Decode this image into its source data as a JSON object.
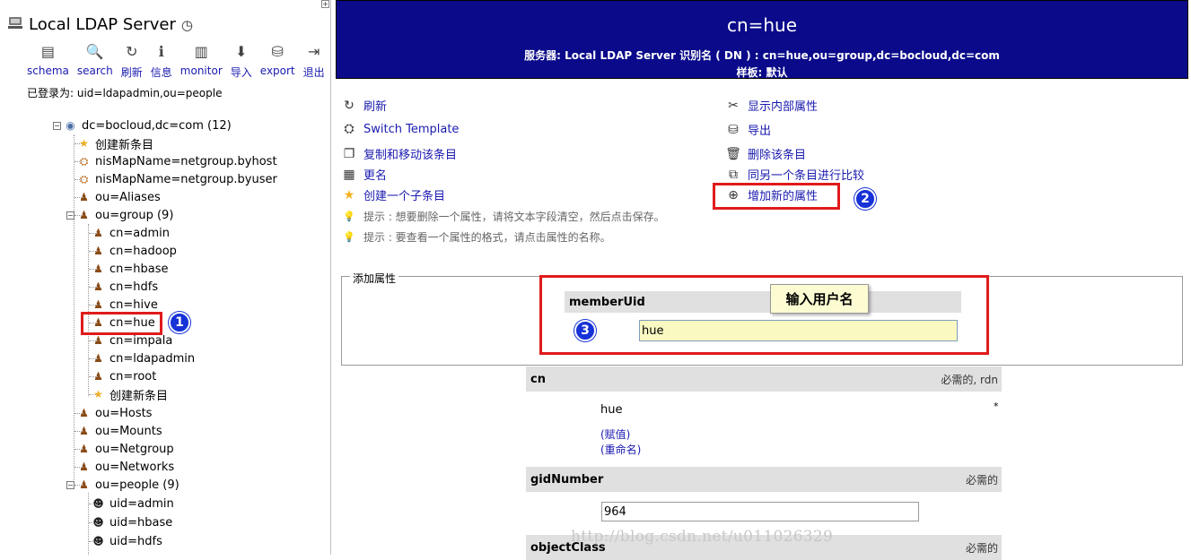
{
  "sidebar": {
    "server_title": "Local LDAP Server",
    "toolbar": [
      {
        "label": "schema",
        "icon": "schema-icon",
        "glyph": "▤"
      },
      {
        "label": "search",
        "icon": "search-icon",
        "glyph": "🔍"
      },
      {
        "label": "刷新",
        "icon": "refresh-icon",
        "glyph": "↻"
      },
      {
        "label": "信息",
        "icon": "info-icon",
        "glyph": "ℹ"
      },
      {
        "label": "monitor",
        "icon": "monitor-icon",
        "glyph": "▥"
      },
      {
        "label": "导入",
        "icon": "import-icon",
        "glyph": "⬇"
      },
      {
        "label": "export",
        "icon": "export-icon",
        "glyph": "⛁"
      },
      {
        "label": "退出",
        "icon": "logout-icon",
        "glyph": "⇥"
      }
    ],
    "logged_in": "已登录为: uid=ldapadmin,ou=people",
    "tree": {
      "root": "dc=bocloud,dc=com (12)",
      "create_new": "创建新条目",
      "items": [
        "nisMapName=netgroup.byhost",
        "nisMapName=netgroup.byuser",
        "ou=Aliases"
      ],
      "group": "ou=group (9)",
      "group_children": [
        "cn=admin",
        "cn=hadoop",
        "cn=hbase",
        "cn=hdfs",
        "cn=hive",
        "cn=hue",
        "cn=impala",
        "cn=ldapadmin",
        "cn=root"
      ],
      "group_create": "创建新条目",
      "others": [
        "ou=Hosts",
        "ou=Mounts",
        "ou=Netgroup",
        "ou=Networks"
      ],
      "people": "ou=people (9)",
      "people_children": [
        "uid=admin",
        "uid=hbase",
        "uid=hdfs"
      ]
    }
  },
  "header": {
    "dn_title": "cn=hue",
    "server_line": "服务器: Local LDAP Server   识别名 ( DN ) : cn=hue,ou=group,dc=bocloud,dc=com",
    "template_line": "样板: 默认"
  },
  "actions_left": [
    {
      "label": "刷新",
      "icon": "refresh-icon",
      "glyph": "↻"
    },
    {
      "label": "Switch Template",
      "icon": "switch-template-icon",
      "glyph": "⛭"
    },
    {
      "label": "复制和移动该条目",
      "icon": "copy-icon",
      "glyph": "❐"
    },
    {
      "label": "更名",
      "icon": "rename-icon",
      "glyph": "▦"
    },
    {
      "label": "创建一个子条目",
      "icon": "star-icon",
      "glyph": "★"
    }
  ],
  "hints": [
    "提示 : 想要删除一个属性，请将文本字段清空，然后点击保存。",
    "提示 : 要查看一个属性的格式，请点击属性的名称。"
  ],
  "actions_right": [
    {
      "label": "显示内部属性",
      "icon": "tools-icon",
      "glyph": "✂"
    },
    {
      "label": "导出",
      "icon": "export-icon",
      "glyph": "⛁"
    },
    {
      "label": "删除该条目",
      "icon": "trash-icon",
      "glyph": "🗑"
    },
    {
      "label": "同另一个条目进行比较",
      "icon": "compare-icon",
      "glyph": "⧉"
    },
    {
      "label": "增加新的属性",
      "icon": "add-attribute-icon",
      "glyph": "⊕"
    }
  ],
  "add_attr": {
    "legend": "添加属性",
    "attr_name": "memberUid",
    "tip": "输入用户名",
    "value": "hue"
  },
  "attributes": {
    "cn": {
      "name": "cn",
      "tag": "必需的, rdn",
      "value": "hue",
      "star": "*",
      "link1": "(赋值)",
      "link2": "(重命名)"
    },
    "gid": {
      "name": "gidNumber",
      "tag": "必需的",
      "value": "964"
    },
    "oc": {
      "name": "objectClass",
      "tag": "必需的"
    }
  },
  "badges": [
    "1",
    "2",
    "3"
  ],
  "watermark": "http://blog.csdn.net/u011026329",
  "colors": {
    "header_bg": "#0a0a8a",
    "link": "#1a1ab0",
    "callout": "#e01b1b",
    "badge": "#1732d6"
  }
}
